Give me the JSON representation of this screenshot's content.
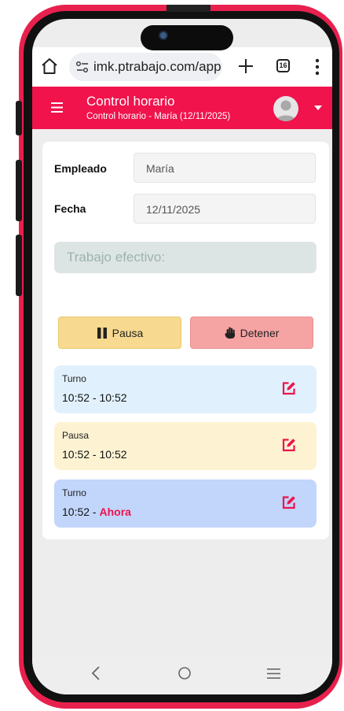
{
  "browser": {
    "url": "imk.ptrabajo.com/app",
    "tab_count": "16"
  },
  "header": {
    "title": "Control horario",
    "subtitle": "Control horario - María (12/11/2025)"
  },
  "form": {
    "employee_label": "Empleado",
    "employee_value": "María",
    "date_label": "Fecha",
    "date_value": "12/11/2025",
    "effective_work_label": "Trabajo efectivo:"
  },
  "actions": {
    "pause_label": "Pausa",
    "stop_label": "Detener"
  },
  "entries": [
    {
      "label": "Turno",
      "time": "10:52 - 10:52"
    },
    {
      "label": "Pausa",
      "time": "10:52 - 10:52"
    },
    {
      "label": "Turno",
      "time_start": "10:52 - ",
      "time_end": "Ahora"
    }
  ],
  "colors": {
    "brand": "#f0134c",
    "phone_frame": "#e8204d",
    "entry_turno": "#e0f1fd",
    "entry_pausa": "#fdf3d2",
    "entry_current": "#c2d5fb",
    "pause_button": "#f7d98f",
    "stop_button": "#f6a3a3"
  },
  "icons": {
    "browser": [
      "home-icon",
      "tune-icon",
      "plus-icon",
      "tabs-icon",
      "more-vert-icon"
    ],
    "header": [
      "menu-icon",
      "avatar",
      "chevron-down-icon"
    ],
    "actions": [
      "pause-icon",
      "hand-icon"
    ],
    "entries": [
      "edit-icon"
    ],
    "navigation": [
      "back-icon",
      "home-circle-icon",
      "recent-apps-icon"
    ]
  }
}
